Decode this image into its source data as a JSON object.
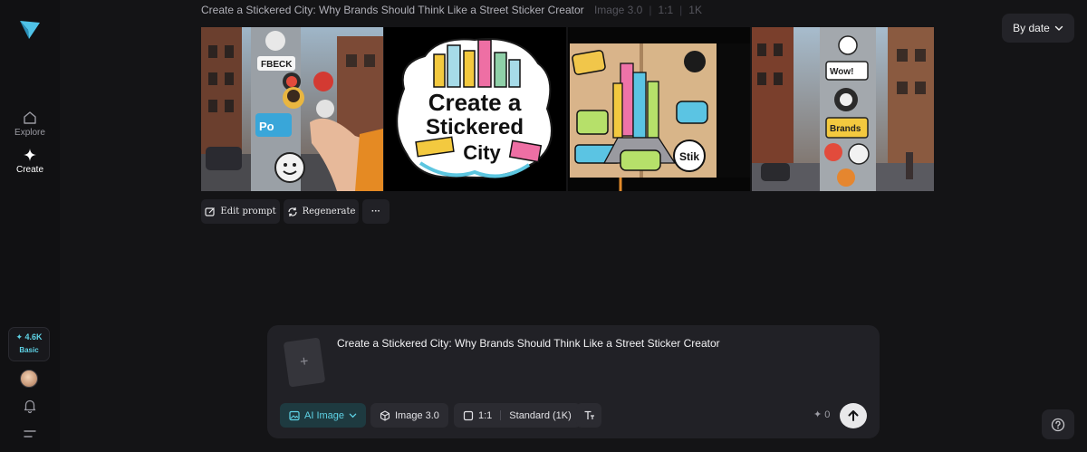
{
  "sidebar": {
    "nav": [
      {
        "label": "Explore",
        "icon": "home-icon"
      },
      {
        "label": "Create",
        "icon": "sparkle-icon"
      }
    ],
    "credits": {
      "amount": "✦ 4.6K",
      "plan": "Basic"
    }
  },
  "header": {
    "title": "Create a Stickered City: Why Brands Should Think Like a Street Sticker Creator",
    "model": "Image 3.0",
    "ratio": "1:1",
    "resolution": "1K",
    "sort_label": "By date"
  },
  "gallery": {
    "images": [
      {
        "name": "sticker-pole-hand",
        "poster_text": [
          "FBECK",
          "Po"
        ]
      },
      {
        "name": "create-a-stickered-city-logo",
        "poster_text": [
          "Create a",
          "Stickered",
          "City"
        ]
      },
      {
        "name": "sticker-sketchbook",
        "poster_text": [
          "Stik"
        ]
      },
      {
        "name": "sticker-pole-street",
        "poster_text": [
          "Wow!",
          "Brands"
        ]
      }
    ],
    "actions": {
      "edit_prompt": "Edit prompt",
      "regenerate": "Regenerate",
      "more": "···"
    }
  },
  "composer": {
    "prompt": "Create a Stickered City: Why Brands Should Think Like a Street Sticker Creator",
    "upload_plus": "+",
    "mode": "AI Image",
    "model": "Image 3.0",
    "ratio": "1:1",
    "quality": "Standard (1K)",
    "cost": "✦ 0"
  },
  "colors": {
    "background": "#141416",
    "panel": "#212126",
    "accent": "#5fd3e6"
  }
}
